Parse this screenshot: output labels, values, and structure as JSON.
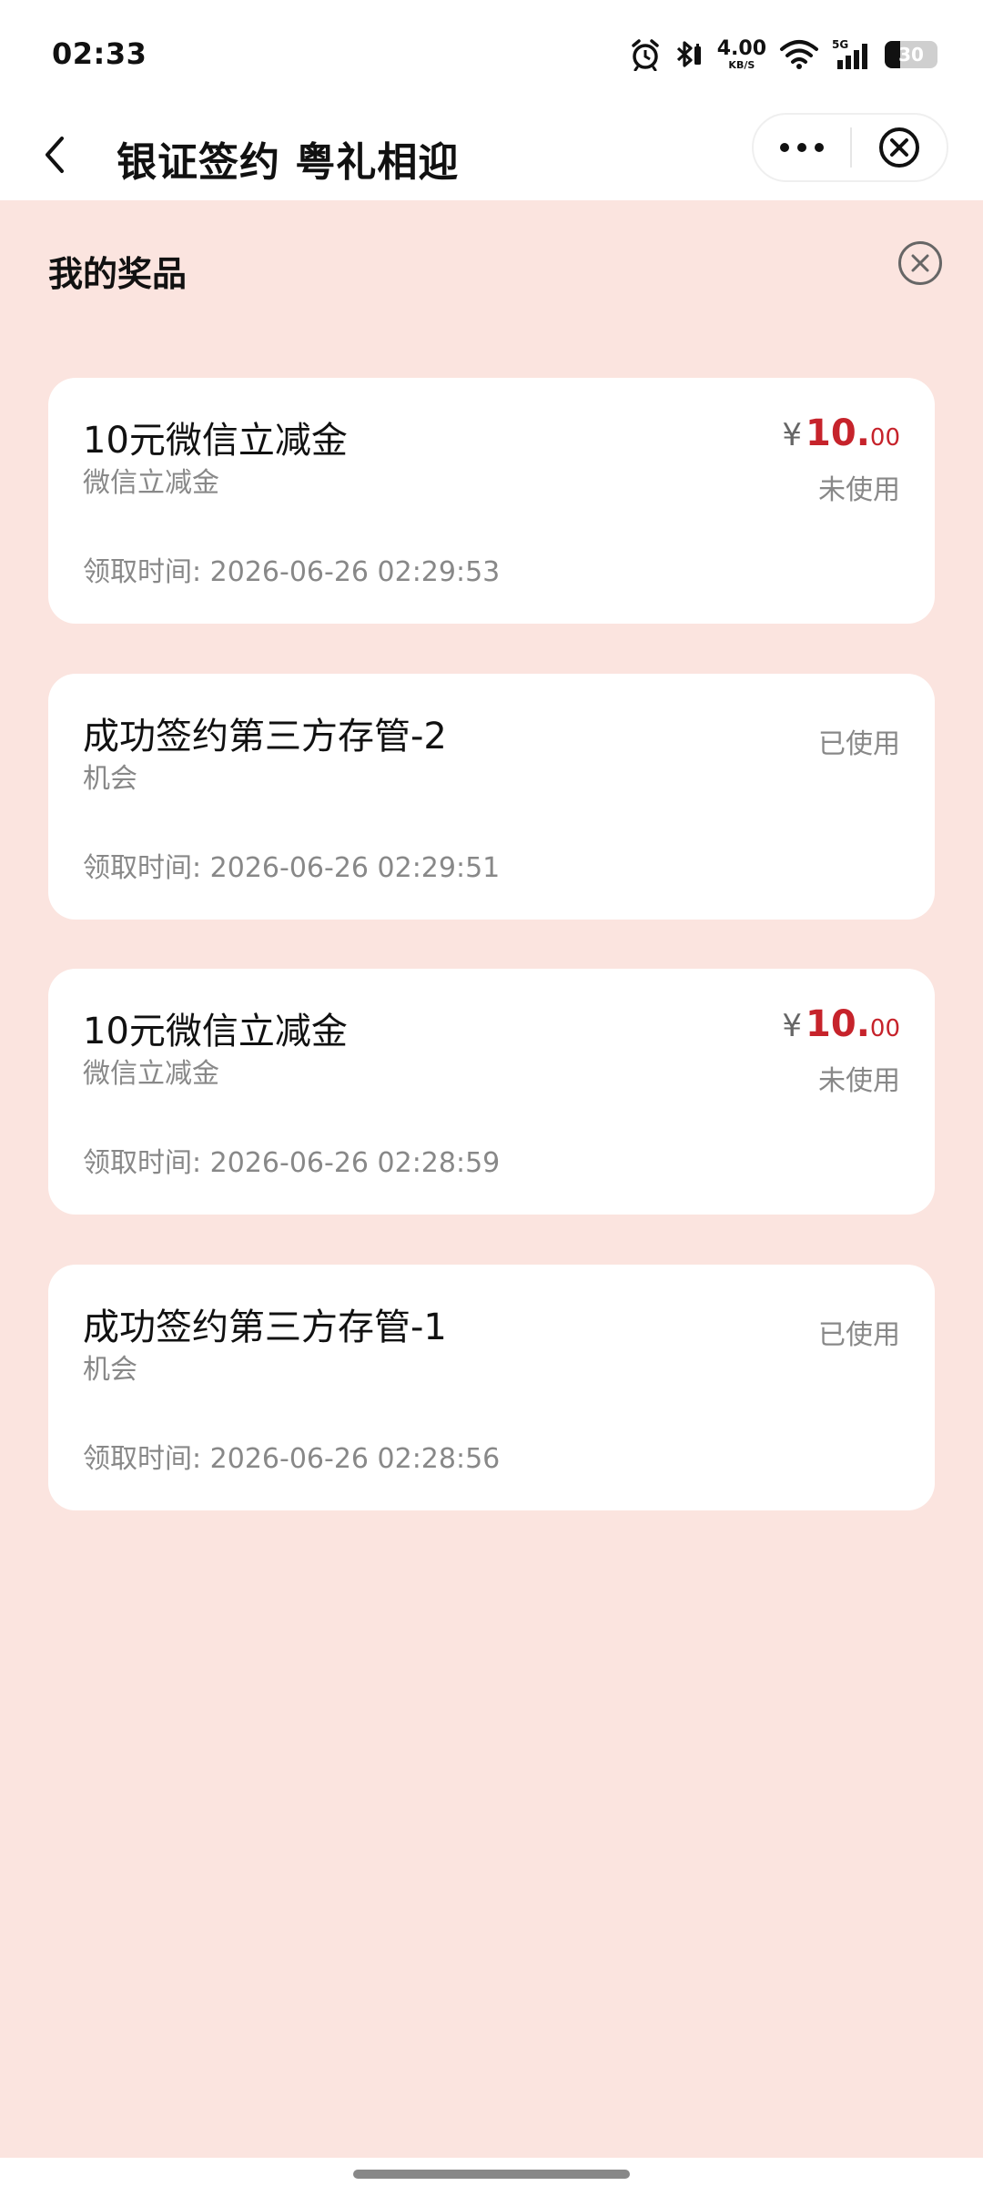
{
  "status_bar": {
    "time": "02:33",
    "net_speed_value": "4.00",
    "net_speed_unit": "KB/S",
    "network_type": "5G",
    "battery_level": "30",
    "icons": [
      "alarm-icon",
      "bluetooth-icon",
      "wifi-icon",
      "signal-icon",
      "battery-icon"
    ]
  },
  "nav": {
    "title": "银证签约 粤礼相迎",
    "icons": [
      "back-icon",
      "more-icon",
      "close-icon"
    ]
  },
  "panel": {
    "title": "我的奖品",
    "close_icon": "close-circle-icon"
  },
  "prizes": [
    {
      "name": "10元微信立减金",
      "subtitle": "微信立减金",
      "time": "领取时间: 2026-06-26 02:29:53",
      "currency": "¥",
      "amount_int": "10.",
      "amount_dec": "00",
      "status": "未使用"
    },
    {
      "name": "成功签约第三方存管-2",
      "subtitle": "机会",
      "time": "领取时间: 2026-06-26 02:29:51",
      "status": "已使用"
    },
    {
      "name": "10元微信立减金",
      "subtitle": "微信立减金",
      "time": "领取时间: 2026-06-26 02:28:59",
      "currency": "¥",
      "amount_int": "10.",
      "amount_dec": "00",
      "status": "未使用"
    },
    {
      "name": "成功签约第三方存管-1",
      "subtitle": "机会",
      "time": "领取时间: 2026-06-26 02:28:56",
      "status": "已使用"
    }
  ],
  "colors": {
    "background": "#fbe4df",
    "card": "#ffffff",
    "amount": "#c6232b",
    "muted_text": "#888888"
  }
}
